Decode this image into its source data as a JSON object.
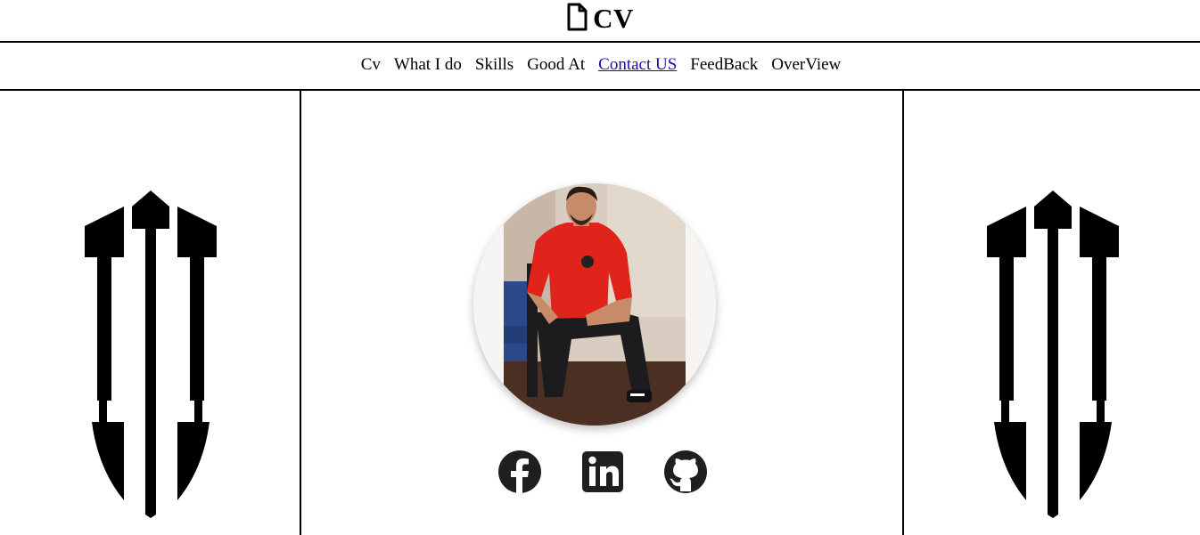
{
  "header": {
    "title": "CV",
    "icon": "document-icon"
  },
  "nav": {
    "items": [
      {
        "label": "Cv",
        "active": false
      },
      {
        "label": "What I do",
        "active": false
      },
      {
        "label": "Skills",
        "active": false
      },
      {
        "label": "Good At",
        "active": false
      },
      {
        "label": "Contact US",
        "active": true
      },
      {
        "label": "FeedBack",
        "active": false
      },
      {
        "label": "OverView",
        "active": false
      }
    ]
  },
  "profile": {
    "photo": "profile-photo",
    "social": [
      {
        "icon": "facebook-icon"
      },
      {
        "icon": "linkedin-icon"
      },
      {
        "icon": "github-icon"
      }
    ]
  },
  "colors": {
    "link_active": "#1a0dab",
    "icon": "#1f1f1f",
    "shirt": "#e0231b"
  }
}
